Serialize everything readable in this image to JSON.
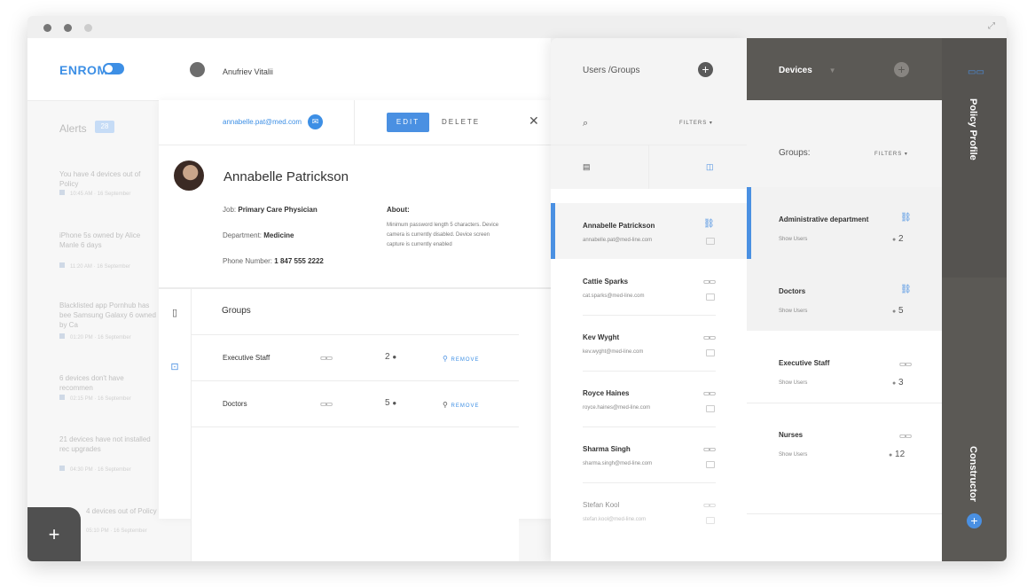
{
  "window": {
    "dot_colors": [
      "#777777",
      "#777777",
      "#cccccc"
    ]
  },
  "header": {
    "logo": "ENROM",
    "user_name": "Anufriev Vitalii"
  },
  "alerts": {
    "title": "Alerts",
    "count": "28",
    "items": [
      {
        "text": "You have 4 devices out of Policy",
        "time": "10:45 AM",
        "date": "16 September"
      },
      {
        "text": "iPhone 5s owned by Alice Manle 6 days",
        "time": "11:20 AM",
        "date": "16 September"
      },
      {
        "text": "Blacklisted app Pornhub has bee Samsung Galaxy 6 owned by Ca",
        "time": "01:20 PM",
        "date": "16 September"
      },
      {
        "text": "6 devices don't have recommen",
        "time": "02:15 PM",
        "date": "16 September"
      },
      {
        "text": "21 devices have not installed rec upgrades",
        "time": "04:30 PM",
        "date": "16 September"
      },
      {
        "text": "4 devices out of Policy",
        "time": "05:10 PM",
        "date": "16 September"
      }
    ]
  },
  "detail": {
    "email": "annabelle.pat@med.com",
    "edit_label": "EDIT",
    "delete_label": "DELETE",
    "name": "Annabelle Patrickson",
    "job_label": "Job:",
    "job": "Primary Care Physician",
    "department_label": "Department:",
    "department": "Medicine",
    "phone_label": "Phone Number:",
    "phone": "1 847 555 2222",
    "about_label": "About:",
    "about": "Minimum password length 5 characters. Device camera is currently disabled. Device screen capture is currently enabled",
    "groups_title": "Groups",
    "groups": [
      {
        "name": "Executive Staff",
        "count": "2",
        "action": "REMOVE"
      },
      {
        "name": "Doctors",
        "count": "5",
        "action": "REMOVE"
      }
    ]
  },
  "users_panel": {
    "title": "Users /Groups",
    "filters_label": "FILTERS",
    "users": [
      {
        "name": "Annabelle Patrickson",
        "email": "annabelle.pat@med-line.com"
      },
      {
        "name": "Cattie Sparks",
        "email": "cat.sparks@med-line.com"
      },
      {
        "name": "Kev Wyght",
        "email": "kev.wyght@med-line.com"
      },
      {
        "name": "Royce Haines",
        "email": "royce.haines@med-line.com"
      },
      {
        "name": "Sharma Singh",
        "email": "sharma.singh@med-line.com"
      },
      {
        "name": "Stefan Kool",
        "email": "stefan.kool@med-line.com"
      }
    ]
  },
  "devices_panel": {
    "title": "Devices",
    "groups_label": "Groups:",
    "filters_label": "FILTERS",
    "groups": [
      {
        "name": "Administrative department",
        "show": "Show Users",
        "count": "2"
      },
      {
        "name": "Doctors",
        "show": "Show Users",
        "count": "5"
      },
      {
        "name": "Executive Staff",
        "show": "Show Users",
        "count": "3"
      },
      {
        "name": "Nurses",
        "show": "Show Users",
        "count": "12"
      }
    ]
  },
  "rail": {
    "policy_label": "Policy Profile",
    "constructor_label": "Constructor"
  },
  "fab": {
    "label": "+"
  },
  "colors": {
    "accent": "#4a90e2",
    "dark_panel": "#5b5955"
  }
}
